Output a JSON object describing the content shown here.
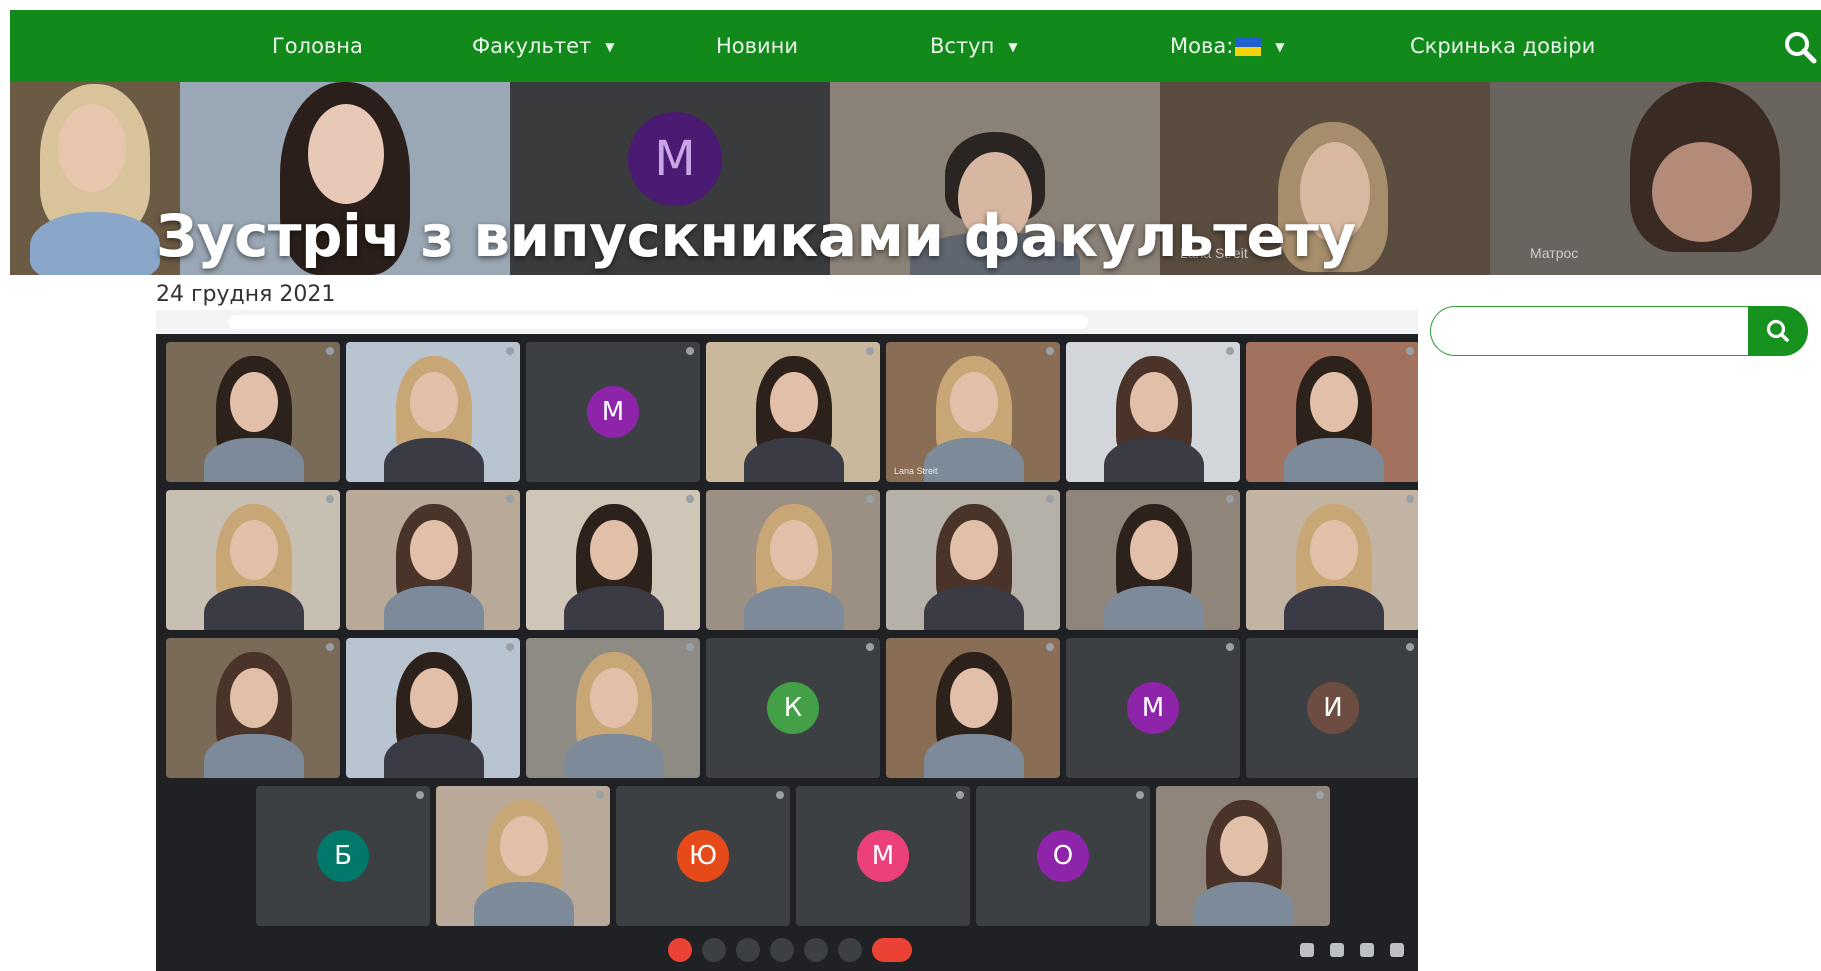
{
  "nav": {
    "items": [
      {
        "label": "Головна",
        "dropdown": false
      },
      {
        "label": "Факультет",
        "dropdown": true
      },
      {
        "label": "Новини",
        "dropdown": false
      },
      {
        "label": "Вступ",
        "dropdown": true
      },
      {
        "label": "Мова:",
        "dropdown": true,
        "flag": "ukraine-flag"
      },
      {
        "label": "Скринька довіри",
        "dropdown": false
      }
    ],
    "search_icon": "search-icon",
    "bg_color": "#128a1b"
  },
  "banner": {
    "title": "Зустріч з випускниками факультету",
    "names": [
      "Lana Streit",
      "Матрос"
    ],
    "avatar_letter": "M"
  },
  "post": {
    "date": "24 грудня 2021"
  },
  "meeting": {
    "tiles": [
      {
        "type": "video"
      },
      {
        "type": "video"
      },
      {
        "type": "avatar",
        "letter": "M",
        "color": "#8e24aa"
      },
      {
        "type": "video"
      },
      {
        "type": "video",
        "name": "Lana Streit"
      },
      {
        "type": "video"
      },
      {
        "type": "video"
      },
      {
        "type": "video"
      },
      {
        "type": "video"
      },
      {
        "type": "video"
      },
      {
        "type": "video"
      },
      {
        "type": "video"
      },
      {
        "type": "video"
      },
      {
        "type": "video"
      },
      {
        "type": "video"
      },
      {
        "type": "video"
      },
      {
        "type": "video"
      },
      {
        "type": "avatar",
        "letter": "К",
        "color": "#43a047"
      },
      {
        "type": "video"
      },
      {
        "type": "avatar",
        "letter": "М",
        "color": "#8e24aa"
      },
      {
        "type": "avatar",
        "letter": "И",
        "color": "#6d4c41"
      },
      {
        "type": "avatar",
        "letter": "Б",
        "color": "#00796b"
      },
      {
        "type": "video"
      },
      {
        "type": "avatar",
        "letter": "Ю",
        "color": "#e64a19"
      },
      {
        "type": "avatar",
        "letter": "М",
        "color": "#ec407a"
      },
      {
        "type": "avatar",
        "letter": "О",
        "color": "#8e24aa"
      },
      {
        "type": "video"
      }
    ]
  },
  "sidebar": {
    "search_placeholder": "",
    "search_icon": "search-icon",
    "accent": "#17921f"
  }
}
